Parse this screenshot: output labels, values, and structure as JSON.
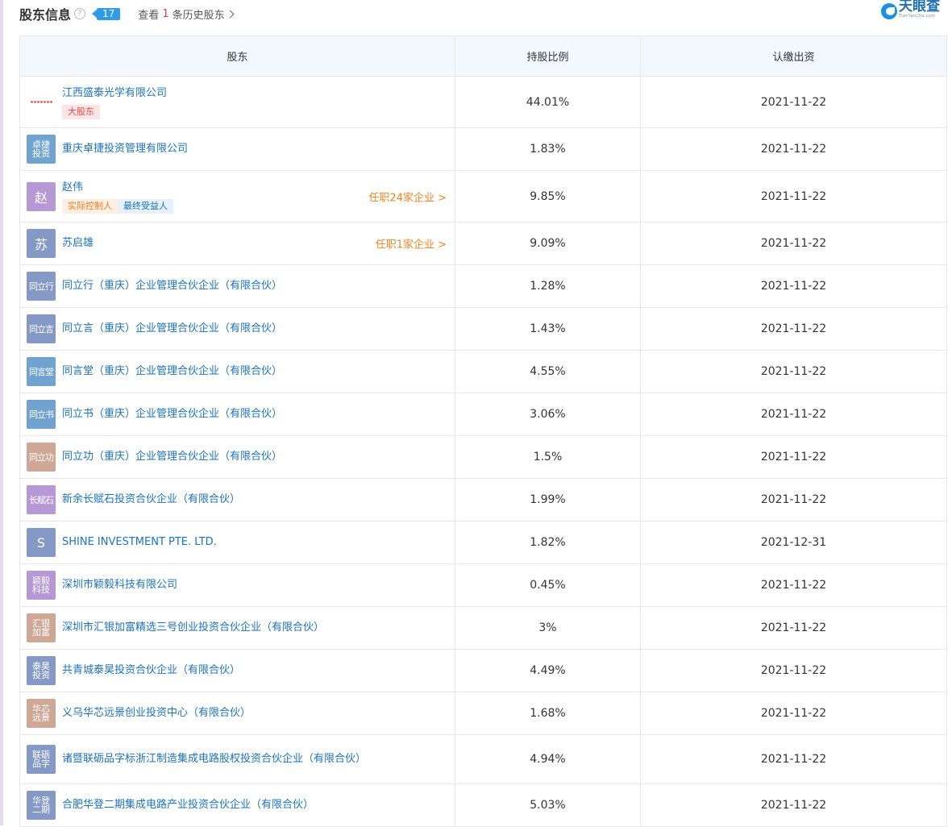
{
  "header": {
    "title": "股东信息",
    "help_icon": "question-circle-icon",
    "count": "17",
    "history_prefix": "查看",
    "history_count": "1",
    "history_suffix": "条历史股东",
    "logo_cn": "天眼查",
    "logo_en": "TianYanCha.com"
  },
  "table": {
    "headers": [
      "股东",
      "持股比例",
      "认缴出资"
    ],
    "rows": [
      {
        "avatar": "",
        "avatar_bg": "#ffffff",
        "name": "江西盛泰光学有限公司",
        "tags": [
          {
            "text": "大股东",
            "style": "red"
          }
        ],
        "job": "",
        "pct": "44.01%",
        "date": "2021-11-22",
        "h": 64
      },
      {
        "avatar": "卓捷投资",
        "avatar_bg": "#71a3d1",
        "name": "重庆卓捷投资管理有限公司",
        "tags": [],
        "job": "",
        "pct": "1.83%",
        "date": "2021-11-22",
        "h": 53
      },
      {
        "avatar": "赵",
        "avatar_bg": "#b699d4",
        "name": "赵伟",
        "tags": [
          {
            "text": "实际控制人",
            "style": "orange"
          },
          {
            "text": "最终受益人",
            "style": "blue"
          }
        ],
        "job": "任职24家企业 >",
        "pct": "9.85%",
        "date": "2021-11-22",
        "h": 64
      },
      {
        "avatar": "苏",
        "avatar_bg": "#8499c6",
        "name": "苏启雄",
        "tags": [],
        "job": "任职1家企业 >",
        "pct": "9.09%",
        "date": "2021-11-22",
        "h": 53
      },
      {
        "avatar": "同立行",
        "avatar_bg": "#8499c6",
        "name": "同立行（重庆）企业管理合伙企业（有限合伙）",
        "tags": [],
        "job": "",
        "pct": "1.28%",
        "date": "2021-11-22",
        "h": 53
      },
      {
        "avatar": "同立言",
        "avatar_bg": "#8499c6",
        "name": "同立言（重庆）企业管理合伙企业（有限合伙）",
        "tags": [],
        "job": "",
        "pct": "1.43%",
        "date": "2021-11-22",
        "h": 53
      },
      {
        "avatar": "同言堂",
        "avatar_bg": "#71a3d1",
        "name": "同言堂（重庆）企业管理合伙企业（有限合伙）",
        "tags": [],
        "job": "",
        "pct": "4.55%",
        "date": "2021-11-22",
        "h": 53
      },
      {
        "avatar": "同立书",
        "avatar_bg": "#71a3d1",
        "name": "同立书（重庆）企业管理合伙企业（有限合伙）",
        "tags": [],
        "job": "",
        "pct": "3.06%",
        "date": "2021-11-22",
        "h": 53
      },
      {
        "avatar": "同立功",
        "avatar_bg": "#cfa796",
        "name": "同立功（重庆）企业管理合伙企业（有限合伙）",
        "tags": [],
        "job": "",
        "pct": "1.5%",
        "date": "2021-11-22",
        "h": 53
      },
      {
        "avatar": "长赋石",
        "avatar_bg": "#b699d4",
        "name": "新余长赋石投资合伙企业（有限合伙）",
        "tags": [],
        "job": "",
        "pct": "1.99%",
        "date": "2021-11-22",
        "h": 53
      },
      {
        "avatar": "S",
        "avatar_bg": "#8499c6",
        "name": "SHINE INVESTMENT PTE. LTD.",
        "tags": [],
        "job": "",
        "pct": "1.82%",
        "date": "2021-12-31",
        "h": 53
      },
      {
        "avatar": "颖毅科技",
        "avatar_bg": "#b699d4",
        "name": "深圳市颖毅科技有限公司",
        "tags": [],
        "job": "",
        "pct": "0.45%",
        "date": "2021-11-22",
        "h": 53
      },
      {
        "avatar": "汇银加富",
        "avatar_bg": "#cfa796",
        "name": "深圳市汇银加富精选三号创业投资合伙企业（有限合伙）",
        "tags": [],
        "job": "",
        "pct": "3%",
        "date": "2021-11-22",
        "h": 53
      },
      {
        "avatar": "泰昊投资",
        "avatar_bg": "#8499c6",
        "name": "共青城泰昊投资合伙企业（有限合伙）",
        "tags": [],
        "job": "",
        "pct": "4.49%",
        "date": "2021-11-22",
        "h": 53
      },
      {
        "avatar": "华芯远景",
        "avatar_bg": "#cfa796",
        "name": "义乌华芯远景创业投资中心（有限合伙）",
        "tags": [],
        "job": "",
        "pct": "1.68%",
        "date": "2021-11-22",
        "h": 53
      },
      {
        "avatar": "联砺品字",
        "avatar_bg": "#8499c6",
        "name": "诸暨联砺品字标浙江制造集成电路股权投资合伙企业（有限合伙）",
        "tags": [],
        "job": "",
        "pct": "4.94%",
        "date": "2021-11-22",
        "h": 61
      },
      {
        "avatar": "华登二期",
        "avatar_bg": "#8499c6",
        "name": "合肥华登二期集成电路产业投资合伙企业（有限合伙）",
        "tags": [],
        "job": "",
        "pct": "5.03%",
        "date": "2021-11-22",
        "h": 53
      }
    ]
  }
}
